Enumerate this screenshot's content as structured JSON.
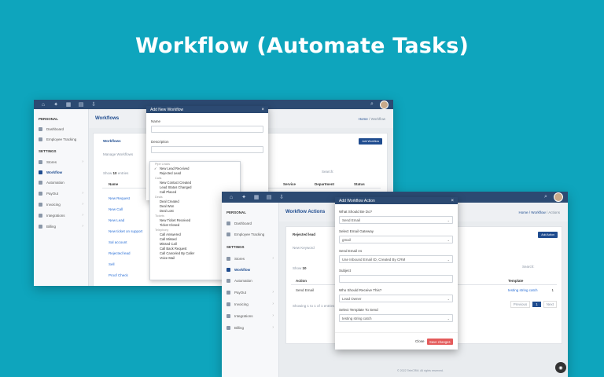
{
  "hero": {
    "title": "Workflow (Automate Tasks)"
  },
  "win1": {
    "sidebar": {
      "personal": "PERSONAL",
      "items_personal": [
        "Dashboard",
        "Employee Tracking"
      ],
      "settings": "SETTINGS",
      "items_settings": [
        "Stores",
        "Workflow",
        "Automation",
        "PayOut",
        "Invoicing",
        "Integrations",
        "Billing"
      ]
    },
    "page_title": "Workflows",
    "crumb_home": "Home",
    "crumb_current": "/ Workflow",
    "card_title": "Workflows",
    "card_sub": "Manage Workflows",
    "add_btn": "Add Workflow",
    "show_label": "Show",
    "show_value": "10",
    "entries_label": "entries",
    "search_label": "Search:",
    "col_name": "Name",
    "col_service": "Service",
    "col_department": "Department",
    "col_status": "Status",
    "rows": [
      "New Request",
      "New Call",
      "New Lead",
      "New ticket on support",
      "Sal account",
      "Rejected lead",
      "Sell",
      "Proof Check"
    ]
  },
  "modal1": {
    "title": "Add New Workflow",
    "name_label": "Name",
    "desc_label": "Description",
    "dropdown": [
      {
        "g": "Pipe Leads"
      },
      {
        "o": "New Lead Received",
        "sel": true
      },
      {
        "o": "Rejected Lead"
      },
      {
        "g": "Calls"
      },
      {
        "o": "New Contact Created"
      },
      {
        "o": "Lead Status Changed"
      },
      {
        "o": "Call Placed"
      },
      {
        "g": "Deals"
      },
      {
        "o": "Deal Created"
      },
      {
        "o": "Deal Won"
      },
      {
        "o": "Deal Lost"
      },
      {
        "g": "Tickets"
      },
      {
        "o": "New Ticket Received"
      },
      {
        "o": "Ticket Closed"
      },
      {
        "g": "Telephony"
      },
      {
        "o": "Call Answered"
      },
      {
        "o": "Call Missed"
      },
      {
        "o": "Missed Call"
      },
      {
        "o": "Call Back Request"
      },
      {
        "o": "Call Canceled By Caller"
      },
      {
        "o": "Voice Mail"
      }
    ]
  },
  "win2": {
    "sidebar": {
      "personal": "PERSONAL",
      "items_personal": [
        "Dashboard",
        "Employee Tracking"
      ],
      "settings": "SETTINGS",
      "items_settings": [
        "Stores",
        "Workflow",
        "Automation",
        "PayOut",
        "Invoicing",
        "Integrations",
        "Billing"
      ]
    },
    "page_title": "Workflow Actions",
    "crumb_home": "Home",
    "crumb_mid": "/ Workflow",
    "crumb_current": "/ Actions",
    "card_title": "Rejected lead",
    "card_sub": "New Keyword",
    "add_btn": "Add Action",
    "show_label": "Show",
    "show_value": "10",
    "col_action": "Action",
    "col_template": "Template",
    "search_label": "Search:",
    "row_action": "Send Email",
    "row_template": "testing string catch",
    "row_count": "1",
    "showing": "Showing 1 to 1 of 1 entries",
    "prev": "Previous",
    "page": "1",
    "next": "Next",
    "footer": "© 2022 TeleCRM. All rights reserved."
  },
  "modal2": {
    "title": "Add Workflow Action",
    "q1_label": "What Should Be Do?",
    "q1_value": "Send Email",
    "q2_label": "Select Email Gateway",
    "q2_value": "gmail",
    "q3_label": "Send Email As",
    "q3_value": "Use Inbound Email ID, Created By CRM",
    "q4_label": "Subject",
    "q4_value": "",
    "q5_label": "Who Should Receive This?",
    "q5_value": "Lead Owner",
    "q6_label": "Select Template To Send",
    "q6_value": "testing string catch",
    "close": "Close",
    "save": "Save changes"
  }
}
